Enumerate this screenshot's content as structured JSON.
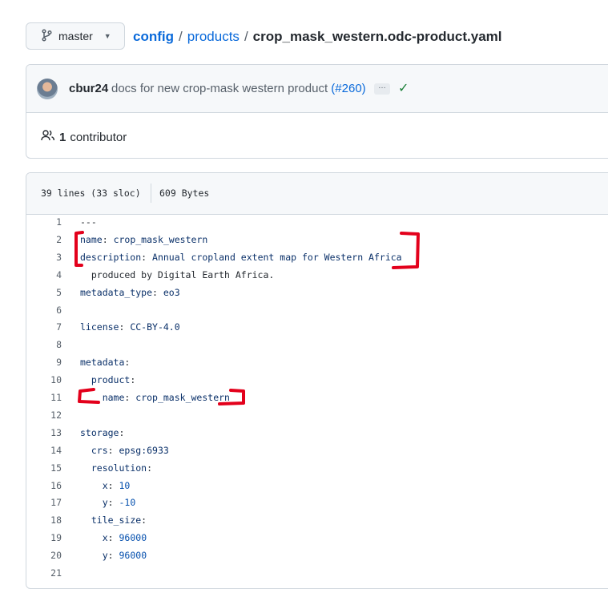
{
  "branch": {
    "label": "master"
  },
  "breadcrumb": {
    "parts": [
      "config",
      "products"
    ],
    "separator": "/",
    "file": "crop_mask_western.odc-product.yaml"
  },
  "commit": {
    "author": "cbur24",
    "message": "docs for new crop-mask western product",
    "pr_link": "(#260)",
    "ellipsis": "…",
    "status": "✓"
  },
  "contributors": {
    "count": "1",
    "label": "contributor"
  },
  "file_info": {
    "lines": "39 lines (33 sloc)",
    "size": "609 Bytes"
  },
  "code": [
    {
      "n": "1",
      "text": "---"
    },
    {
      "n": "2",
      "text": "name: crop_mask_western"
    },
    {
      "n": "3",
      "text": "description: Annual cropland extent map for Western Africa"
    },
    {
      "n": "4",
      "text": "  produced by Digital Earth Africa."
    },
    {
      "n": "5",
      "text": "metadata_type: eo3"
    },
    {
      "n": "6",
      "text": ""
    },
    {
      "n": "7",
      "text": "license: CC-BY-4.0"
    },
    {
      "n": "8",
      "text": ""
    },
    {
      "n": "9",
      "text": "metadata:"
    },
    {
      "n": "10",
      "text": "  product:"
    },
    {
      "n": "11",
      "text": "    name: crop_mask_western"
    },
    {
      "n": "12",
      "text": ""
    },
    {
      "n": "13",
      "text": "storage:"
    },
    {
      "n": "14",
      "text": "  crs: epsg:6933"
    },
    {
      "n": "15",
      "text": "  resolution:"
    },
    {
      "n": "16",
      "text": "    x: 10"
    },
    {
      "n": "17",
      "text": "    y: -10"
    },
    {
      "n": "18",
      "text": "  tile_size:"
    },
    {
      "n": "19",
      "text": "    x: 96000"
    },
    {
      "n": "20",
      "text": "    y: 96000"
    },
    {
      "n": "21",
      "text": ""
    }
  ],
  "colors": {
    "link": "#0969da",
    "annotation": "#e3001b",
    "success": "#1a7f37"
  },
  "icons": {
    "branch": "git-branch-icon",
    "people": "people-icon",
    "check": "check-icon",
    "caret": "caret-down-icon"
  }
}
